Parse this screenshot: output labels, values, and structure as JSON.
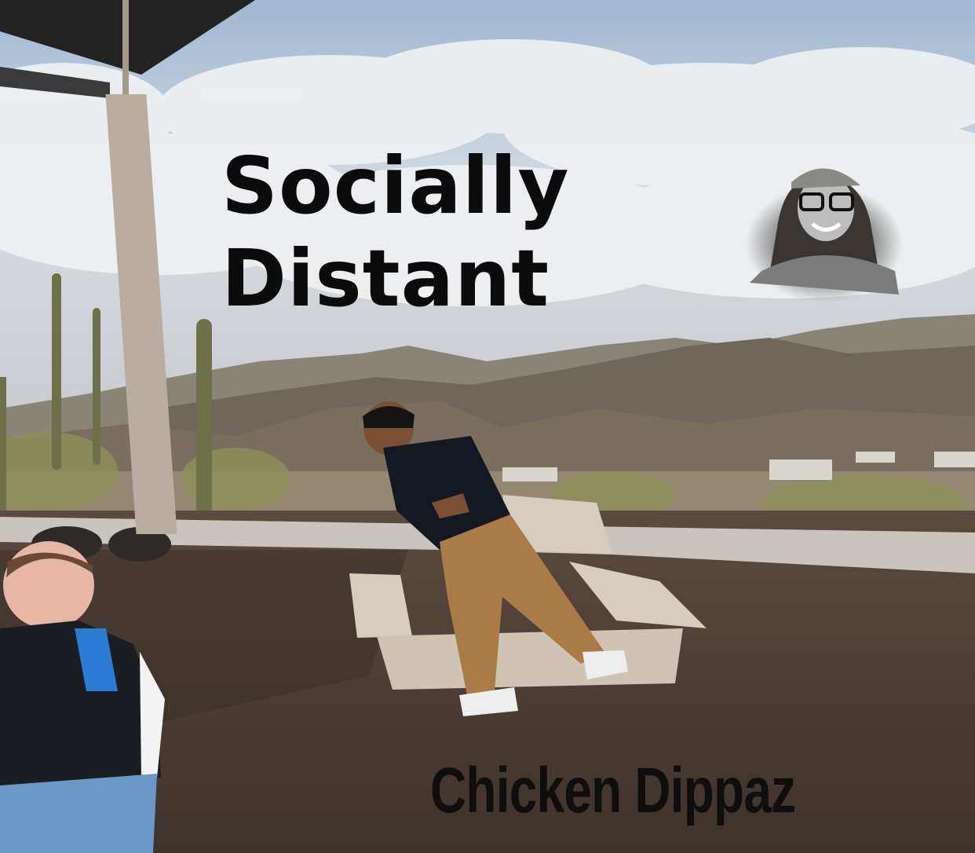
{
  "cover": {
    "title_line1": "Socially",
    "title_line2": "Distant",
    "artist": "Chicken Dippaz"
  },
  "colors": {
    "sky": "#c4d3e3",
    "cloud": "#eef0f2",
    "mountain": "#6f675c",
    "ground": "#4a3c34",
    "text": "#0b0b0b"
  }
}
